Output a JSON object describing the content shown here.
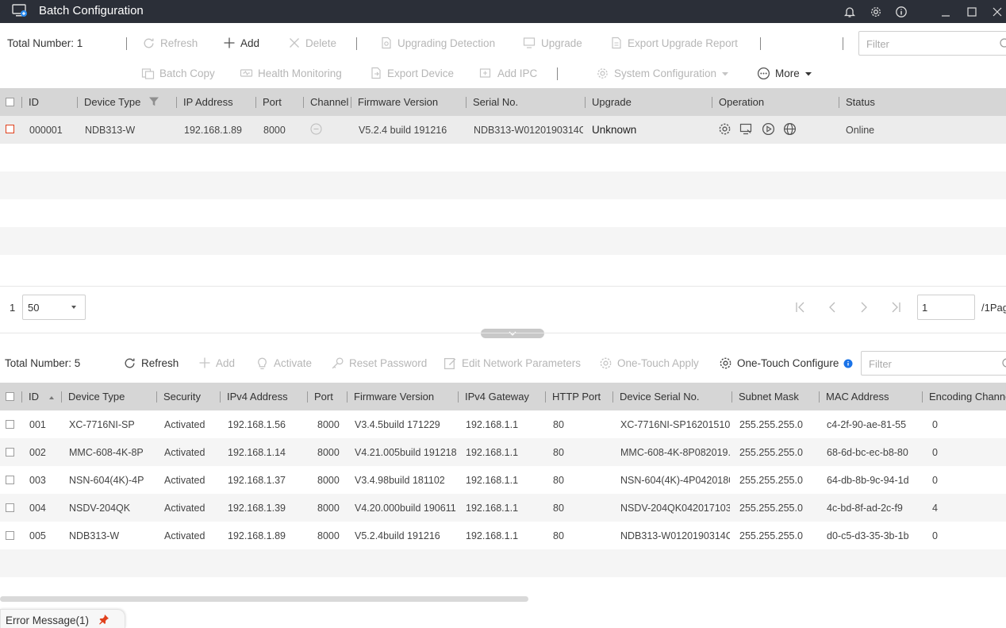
{
  "window": {
    "title": "Batch Configuration"
  },
  "upper": {
    "total": "Total Number: 1",
    "toolbar": {
      "refresh": "Refresh",
      "add": "Add",
      "delete": "Delete",
      "upgrading_detection": "Upgrading Detection",
      "upgrade": "Upgrade",
      "export_upgrade_report": "Export Upgrade Report",
      "batch_copy": "Batch Copy",
      "health_monitoring": "Health Monitoring",
      "export_device": "Export Device",
      "add_ipc": "Add IPC",
      "system_configuration": "System Configuration",
      "more": "More"
    },
    "filter_placeholder": "Filter",
    "columns": {
      "id": "ID",
      "device_type": "Device Type",
      "ip": "IP Address",
      "port": "Port",
      "channel": "Channel",
      "firmware": "Firmware Version",
      "serial": "Serial No.",
      "upgrade": "Upgrade",
      "operation": "Operation",
      "status": "Status"
    },
    "rows": [
      {
        "id": "000001",
        "device_type": "NDB313-W",
        "ip": "192.168.1.89",
        "port": "8000",
        "firmware": "V5.2.4 build 191216",
        "serial": "NDB313-W0120190314C...",
        "upgrade": "Unknown",
        "status": "Online"
      }
    ],
    "pager": {
      "page": "1",
      "page_size": "50",
      "goto": "1",
      "of_pages": "/1Pag"
    }
  },
  "lower": {
    "total": "Total Number: 5",
    "toolbar": {
      "refresh": "Refresh",
      "add": "Add",
      "activate": "Activate",
      "reset_password": "Reset Password",
      "edit_network": "Edit Network Parameters",
      "one_touch_apply": "One-Touch Apply",
      "one_touch_configure": "One-Touch Configure"
    },
    "filter_placeholder": "Filter",
    "columns": {
      "id": "ID",
      "device_type": "Device Type",
      "security": "Security",
      "ipv4": "IPv4 Address",
      "port": "Port",
      "firmware": "Firmware Version",
      "gateway": "IPv4 Gateway",
      "http_port": "HTTP Port",
      "serial": "Device Serial No.",
      "subnet": "Subnet Mask",
      "mac": "MAC Address",
      "encoding": "Encoding Channel"
    },
    "rows": [
      {
        "id": "001",
        "device_type": "XC-7716NI-SP",
        "security": "Activated",
        "ipv4": "192.168.1.56",
        "port": "8000",
        "firmware": "V3.4.5build 171229",
        "gateway": "192.168.1.1",
        "http_port": "80",
        "serial": "XC-7716NI-SP162015101...",
        "subnet": "255.255.255.0",
        "mac": "c4-2f-90-ae-81-55",
        "encoding": "0"
      },
      {
        "id": "002",
        "device_type": "MMC-608-4K-8P",
        "security": "Activated",
        "ipv4": "192.168.1.14",
        "port": "8000",
        "firmware": "V4.21.005build 191218",
        "gateway": "192.168.1.1",
        "http_port": "80",
        "serial": "MMC-608-4K-8P082019...",
        "subnet": "255.255.255.0",
        "mac": "68-6d-bc-ec-b8-80",
        "encoding": "0"
      },
      {
        "id": "003",
        "device_type": "NSN-604(4K)-4P",
        "security": "Activated",
        "ipv4": "192.168.1.37",
        "port": "8000",
        "firmware": "V3.4.98build 181102",
        "gateway": "192.168.1.1",
        "http_port": "80",
        "serial": "NSN-604(4K)-4P0420180...",
        "subnet": "255.255.255.0",
        "mac": "64-db-8b-9c-94-1d",
        "encoding": "0"
      },
      {
        "id": "004",
        "device_type": "NSDV-204QK",
        "security": "Activated",
        "ipv4": "192.168.1.39",
        "port": "8000",
        "firmware": "V4.20.000build 190611",
        "gateway": "192.168.1.1",
        "http_port": "80",
        "serial": "NSDV-204QK042017103...",
        "subnet": "255.255.255.0",
        "mac": "4c-bd-8f-ad-2c-f9",
        "encoding": "4"
      },
      {
        "id": "005",
        "device_type": "NDB313-W",
        "security": "Activated",
        "ipv4": "192.168.1.89",
        "port": "8000",
        "firmware": "V5.2.4build 191216",
        "gateway": "192.168.1.1",
        "http_port": "80",
        "serial": "NDB313-W0120190314C...",
        "subnet": "255.255.255.0",
        "mac": "d0-c5-d3-35-3b-1b",
        "encoding": "0"
      }
    ]
  },
  "footer": {
    "error_tab": "Error Message(1)"
  },
  "colors": {
    "titlebar": "#2b2f38",
    "header": "#d6d6d6",
    "selected_row": "#ececec",
    "accent": "#1a73e8",
    "error_pin": "#e0401c"
  }
}
